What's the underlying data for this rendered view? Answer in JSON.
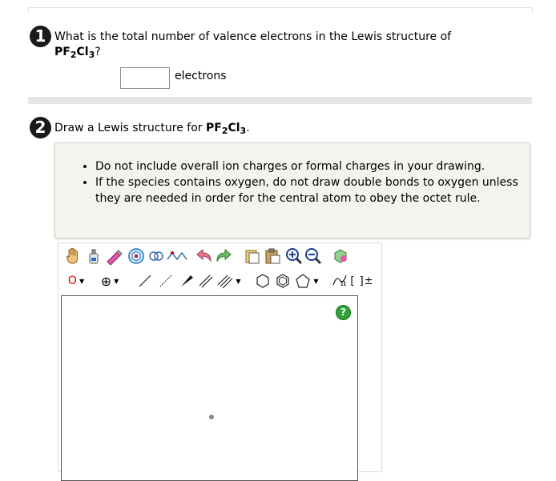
{
  "question1": {
    "number": "1",
    "text": "What is the total number of valence electrons in the Lewis structure of",
    "formula": {
      "main": "PF",
      "sub1": "2",
      "mid": "Cl",
      "sub2": "3"
    },
    "suffix": "?",
    "answer_value": "",
    "unit": "electrons"
  },
  "question2": {
    "number": "2",
    "text": "Draw a Lewis structure for",
    "formula": {
      "main": "PF",
      "sub1": "2",
      "mid": "Cl",
      "sub2": "3"
    },
    "suffix": ".",
    "notes": [
      "Do not include overall ion charges or formal charges in your drawing.",
      "If the species contains oxygen, do not draw double bonds to oxygen unless they are needed in order for the central atom to obey the octet rule."
    ]
  },
  "editor": {
    "element_selected": "O",
    "charge_symbol": "⊕",
    "bracket_label": "[ ]±",
    "sn_label": "n",
    "help_label": "?"
  },
  "colors": {
    "help_green": "#2fa233",
    "element_red": "#d10000",
    "divider": "#e6e6e6",
    "note_bg": "#f4f4ef"
  }
}
